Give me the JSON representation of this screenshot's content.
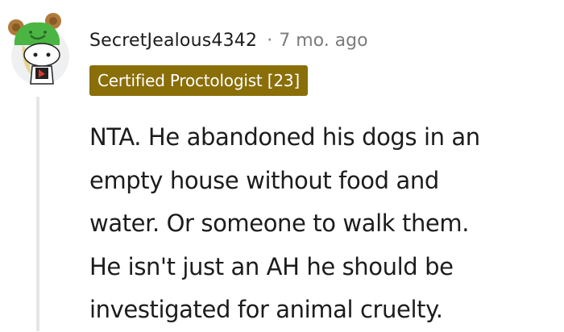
{
  "comment": {
    "username": "SecretJealous4342",
    "separator": "·",
    "timestamp": "7 mo. ago",
    "flair": "Certified Proctologist [23]",
    "body_lines": [
      "NTA. He abandoned his dogs in an",
      "empty house without food and",
      "water. Or someone to walk them.",
      "He isn't just an AH he should be",
      "investigated for animal cruelty."
    ]
  },
  "colors": {
    "flair_background": "#8a6e08",
    "username": "#1c1c1c",
    "meta_gray": "#7c7c7c",
    "thread_line": "#e6e6e6",
    "avatar_hat_green": "#4bb543",
    "avatar_ears_brown": "#b07a3c"
  },
  "icons": {
    "avatar": "snoo-avatar-icon"
  }
}
